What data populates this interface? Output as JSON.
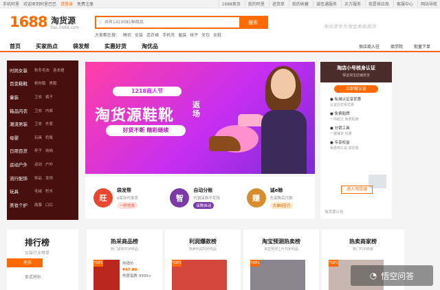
{
  "topbar": {
    "left": [
      "手机阿里",
      "欢迎来到阿里巴巴",
      "请登录",
      "免费注册"
    ],
    "right": [
      "1688首页",
      "我的阿里",
      "进货单",
      "我的收藏",
      "诚信通服务",
      "买方服务",
      "我是供应商",
      "客服中心",
      "网站导航"
    ]
  },
  "header": {
    "logo": "1688",
    "logo_sub": "淘货源",
    "logo_url": "tao.1688.com",
    "search_placeholder": "共有1410081种商品",
    "search_button": "搜索",
    "hot_label": "大家都在搜：",
    "hot": [
      "睡衣",
      "女装",
      "连衣裙",
      "手机壳",
      "童装",
      "袜子",
      "女包",
      "女鞋"
    ],
    "slogan": "淘货源专为淘宝卖家服务"
  },
  "nav": {
    "items": [
      "首页",
      "买家热点",
      "袋发帮",
      "实惠好货",
      "淘优品"
    ],
    "right": [
      "供应商入驻",
      "商学院",
      "批量下单"
    ]
  },
  "sidebar": [
    {
      "cat": "时尚女装",
      "subs": [
        "秋冬毛衣",
        "连衣裙"
      ]
    },
    {
      "cat": "百变鞋靴",
      "subs": [
        "帆布鞋",
        "男鞋"
      ]
    },
    {
      "cat": "童装",
      "subs": [
        "卫衣",
        "裤子"
      ]
    },
    {
      "cat": "箱品内衣",
      "subs": [
        "卫衣",
        "内裤"
      ]
    },
    {
      "cat": "潮流男装",
      "subs": [
        "卫衣",
        "外套"
      ]
    },
    {
      "cat": "母婴",
      "subs": [
        "玩具",
        "奶瓶"
      ]
    },
    {
      "cat": "日用百货",
      "subs": [
        "杯子",
        "收纳"
      ]
    },
    {
      "cat": "运动户外",
      "subs": [
        "运动",
        "户外"
      ]
    },
    {
      "cat": "流行配饰",
      "subs": [
        "饰品",
        "发饰"
      ]
    },
    {
      "cat": "玩具",
      "subs": [
        "毛绒",
        "积木"
      ]
    },
    {
      "cat": "美妆个护",
      "subs": [
        "面膜",
        "口红"
      ]
    }
  ],
  "banner": {
    "label": "1218商人节",
    "title": "淘货源鞋靴",
    "title_side": "返场",
    "pill": "好货不断 精彩继续"
  },
  "features": [
    {
      "icon": "旺",
      "title": "袋发帮",
      "desc": "0库存代发货",
      "tag": "一件代发",
      "color": "#e8482f",
      "tagbg": "#fde2dd",
      "tagfg": "#e8482f"
    },
    {
      "icon": "智",
      "title": "自动分账",
      "desc": "代销采购不花钱",
      "tag": "采购自动",
      "color": "#7a3aa8",
      "tagbg": "#7a3aa8",
      "tagfg": "#ffffff"
    },
    {
      "icon": "赚",
      "title": "诚e赊",
      "desc": "先采购后付款",
      "tag": "大单0压力",
      "color": "#d88c2e",
      "tagbg": "#fde8c8",
      "tagfg": "#c45a00"
    }
  ],
  "right_panel": {
    "title": "淘店小号核身认证",
    "subtitle": "保证淘宝店铺安全",
    "button": "立即做认证",
    "items": [
      {
        "t": "私域认证享优惠",
        "d": "认证后享受优惠"
      },
      {
        "t": "免费贴牌",
        "d": "一件起订 免费贴牌"
      },
      {
        "t": "分销工具",
        "d": "一键铺货 批量"
      },
      {
        "t": "专享权益",
        "d": "免费用工具 享优惠"
      }
    ],
    "enter": "进入淘货源",
    "notice": "淘货源公告"
  },
  "rank": {
    "title": "排行榜",
    "subtitle": "女装行业榜单",
    "tab1": "毛衣",
    "tab2": "女式衬衫"
  },
  "columns": [
    {
      "title": "热采商品榜",
      "sub": "热门采购TOP商品",
      "tag": "TOP1",
      "info1": "热销价",
      "price": "¥47.00",
      "info2": "热度指数 9999+"
    },
    {
      "title": "利润爆款榜",
      "sub": "热卖利润TOP商品",
      "tag": "TOP1"
    },
    {
      "title": "淘宝预测热卖榜",
      "sub": "淘宝预测上升TOP商品",
      "tag": "TOP1"
    },
    {
      "title": "热卖商家榜",
      "sub": "热门TOP商家",
      "tag": "TOP1"
    }
  ],
  "watermark": "悟空问答"
}
